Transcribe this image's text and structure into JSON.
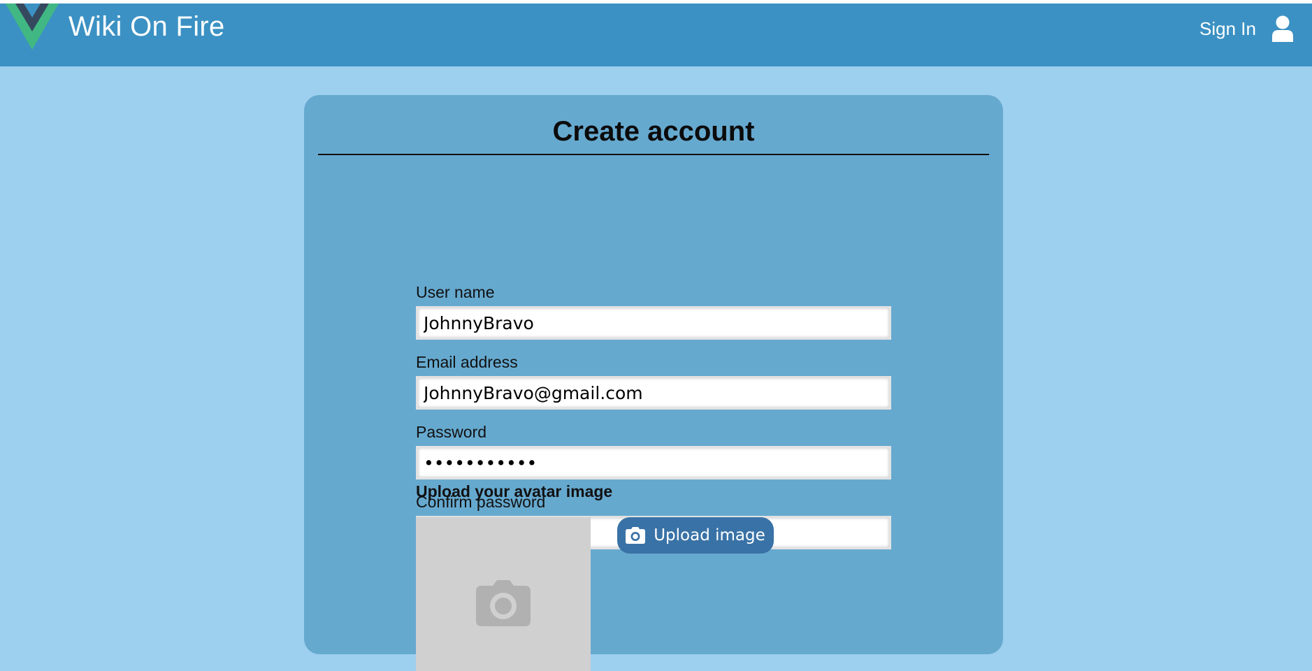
{
  "header": {
    "brand": "Wiki On Fire",
    "logo_icon": "vue-logo-icon",
    "signin_label": "Sign In",
    "user_icon": "user-icon"
  },
  "card": {
    "title": "Create account"
  },
  "form": {
    "username_label": "User name",
    "username_value": "JohnnyBravo",
    "email_label": "Email address",
    "email_value": "JohnnyBravo@gmail.com",
    "password_label": "Password",
    "password_value": "•••••••••••",
    "confirm_label": "Confirm password",
    "confirm_value": "•••••••••••"
  },
  "upload": {
    "title": "Upload your avatar image",
    "button_label": "Upload image",
    "button_icon": "camera-icon",
    "placeholder_icon": "camera-icon"
  },
  "colors": {
    "page_bg": "#9dcfee",
    "navbar": "#3b91c3",
    "card": "#66a9cf",
    "button": "#3972a6",
    "vue_green": "#41b883",
    "vue_dark": "#35495e",
    "avatar_placeholder": "#d0d0d0"
  }
}
